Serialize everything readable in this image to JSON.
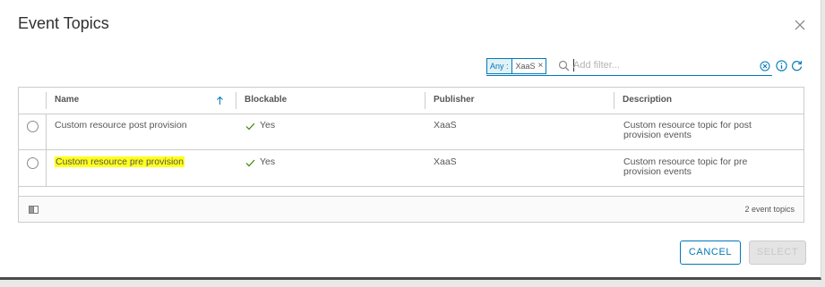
{
  "dialog": {
    "title": "Event Topics"
  },
  "filter": {
    "chip_key": "Any :",
    "chip_value": "XaaS",
    "chip_remove": "×",
    "placeholder": "Add filter..."
  },
  "table": {
    "columns": [
      "Name",
      "Blockable",
      "Publisher",
      "Description"
    ],
    "rows": [
      {
        "name": "Custom resource post provision",
        "blockable": "Yes",
        "publisher": "XaaS",
        "description_line1": "Custom resource topic for post",
        "description_line2": "provision events"
      },
      {
        "name": "Custom resource pre provision",
        "blockable": "Yes",
        "publisher": "XaaS",
        "description_line1": "Custom resource topic for pre",
        "description_line2": "provision events"
      }
    ],
    "footer_count": "2 event topics"
  },
  "actions": {
    "cancel": "CANCEL",
    "select": "SELECT"
  },
  "colors": {
    "accent": "#0079b8",
    "highlight": "#ffff1a",
    "check": "#3c8500"
  },
  "icons": [
    "close-icon",
    "search-icon",
    "clear-filter-icon",
    "info-icon",
    "refresh-icon",
    "sort-ascending-icon",
    "check-icon",
    "column-toggle-icon"
  ]
}
